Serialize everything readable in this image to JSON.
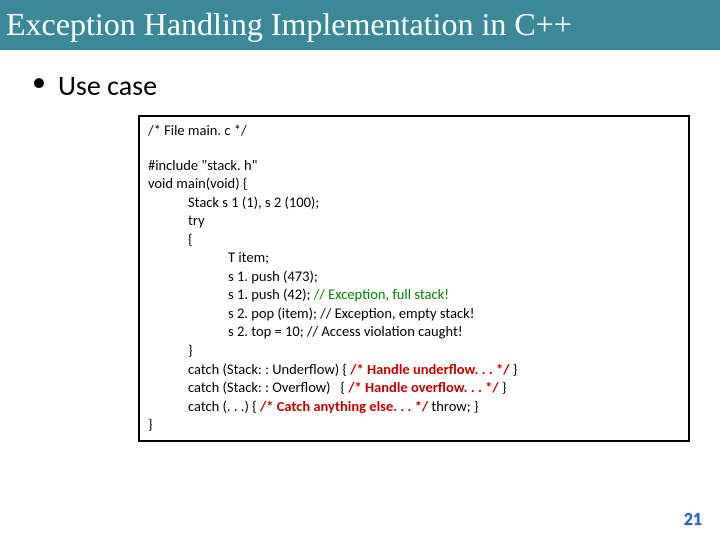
{
  "title": "Exception Handling Implementation in C++",
  "bullet": "Use case",
  "page_number": "21",
  "code": {
    "l01": "/* File main. c */",
    "l02": "#include \"stack. h\"",
    "l03_a": "void",
    "l03_b": " main(",
    "l03_c": "void",
    "l03_d": ") {",
    "l04": "Stack s 1 (1), s 2 (100);",
    "l05": "try",
    "l06": "{",
    "l07": "T item;",
    "l08": "s 1. push (473);",
    "l09_a": "s 1. push (42); ",
    "l09_b": "// Exception, full stack!",
    "l10": "s 2. pop (item); // Exception, empty stack!",
    "l11": "s 2. top = 10; // Access violation caught!",
    "l12": "}",
    "l13_a": "catch (Stack: : Underflow) { ",
    "l13_b": "/* Handle underflow. . . */",
    "l13_c": " }",
    "l14_a": "catch (Stack: : Overflow)   { ",
    "l14_b": "/* Handle overflow. . . */",
    "l14_c": " }",
    "l15_a": "catch (. . .) { ",
    "l15_b": "/* Catch anything else. . . */ ",
    "l15_c": "throw; }",
    "l16": "}"
  }
}
